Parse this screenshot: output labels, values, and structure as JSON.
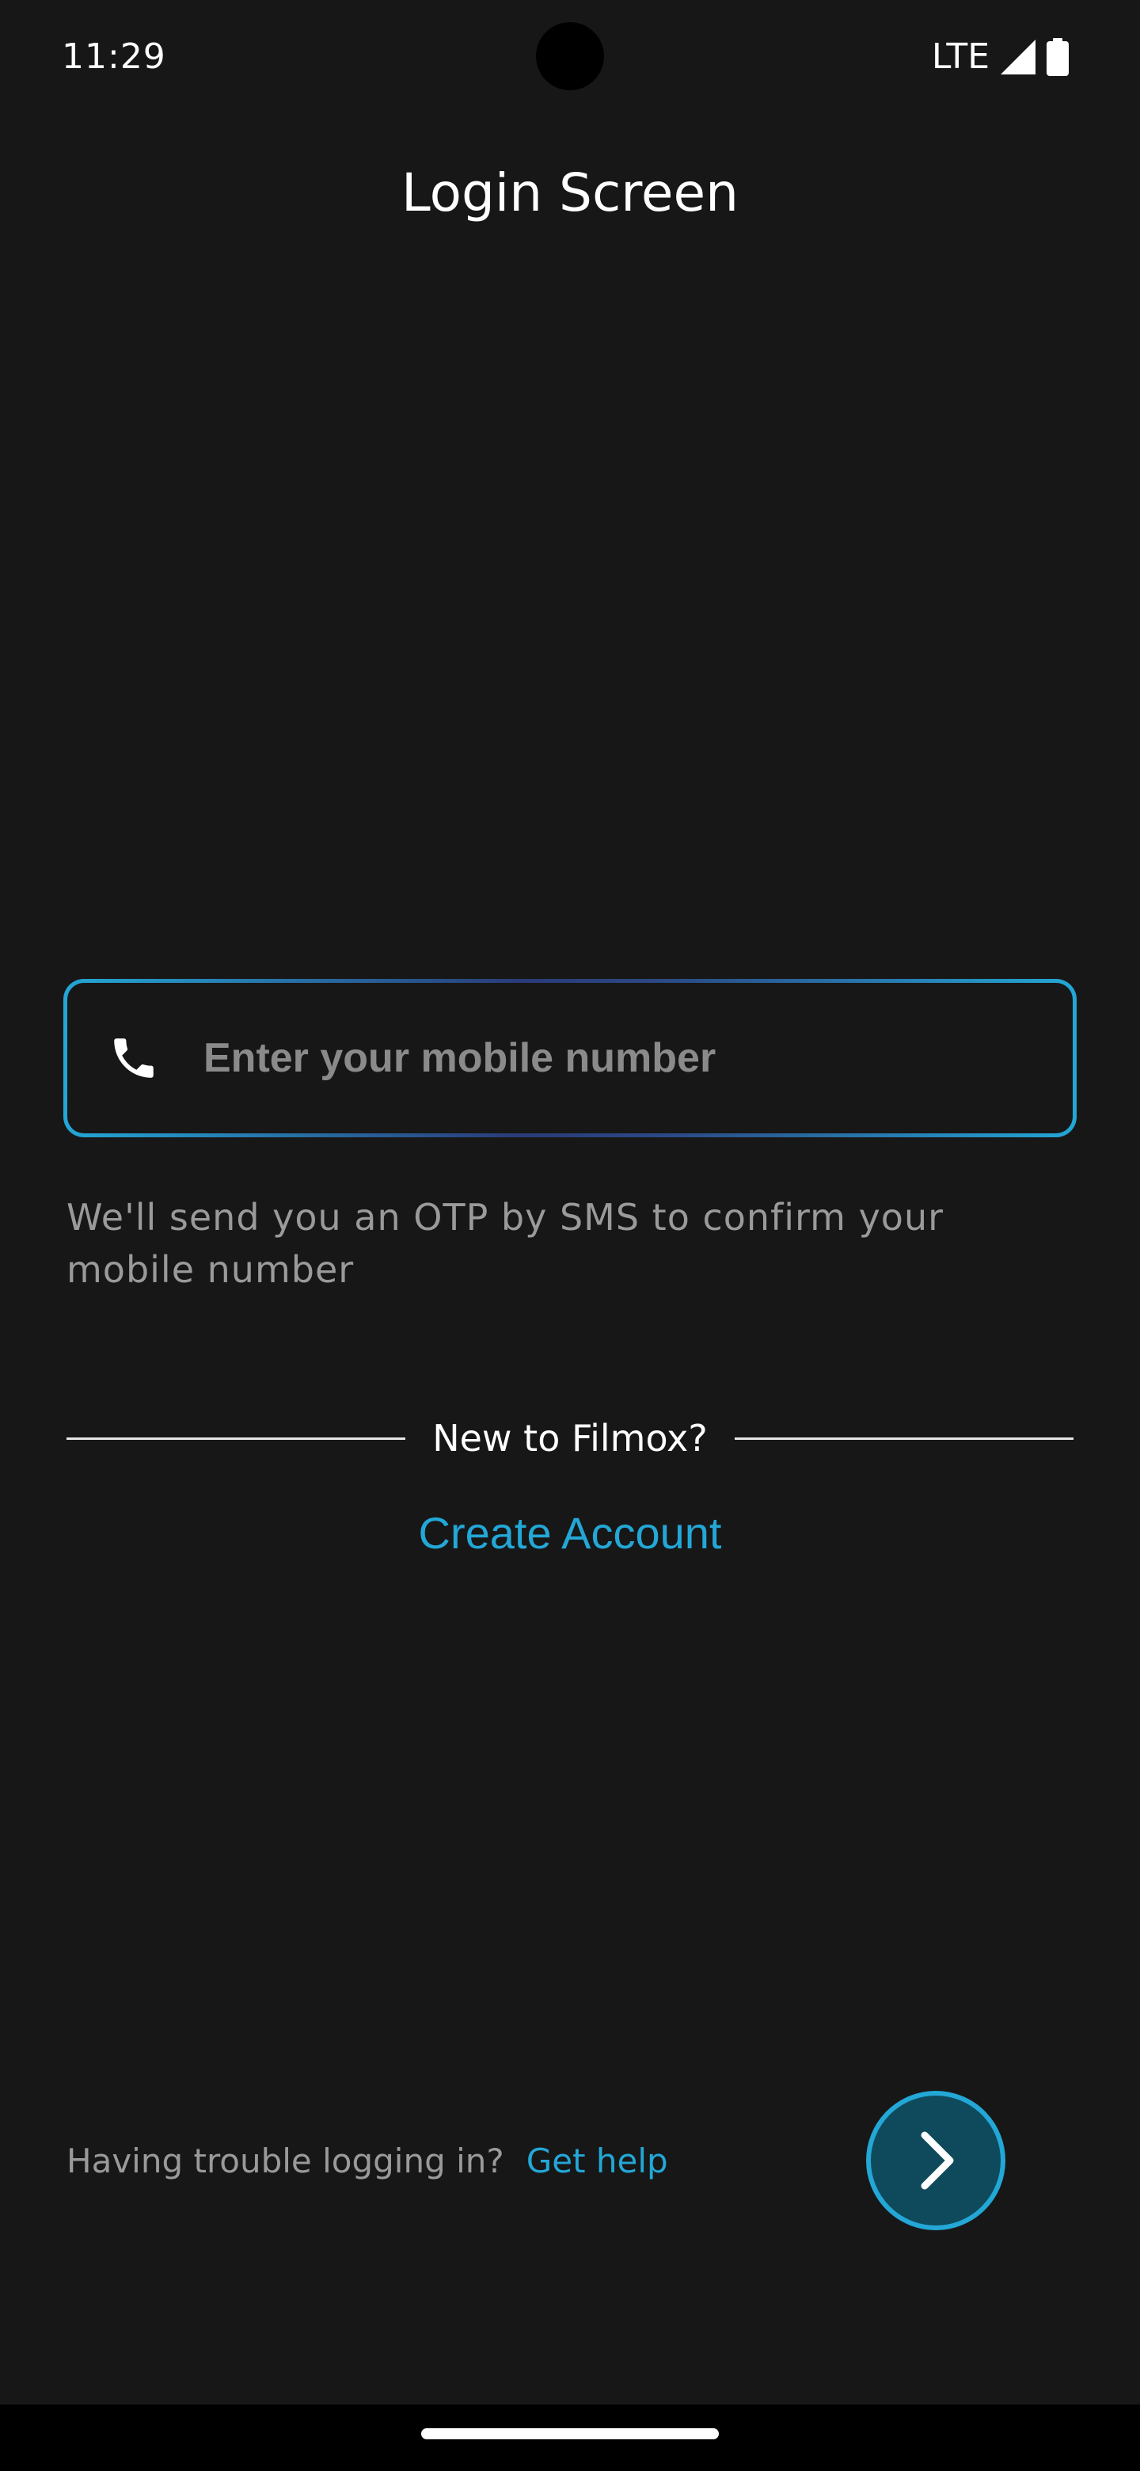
{
  "status_bar": {
    "time": "11:29",
    "network": "LTE"
  },
  "title": "Login Screen",
  "mobile_input": {
    "placeholder": "Enter your mobile number",
    "value": "",
    "icon": "phone-icon"
  },
  "otp_helper_text": "We'll send you an OTP by SMS to confirm your mobile number",
  "divider_text": "New to Filmox?",
  "create_account_label": "Create Account",
  "help": {
    "text": "Having trouble logging in?",
    "link_label": "Get help"
  },
  "next_button": {
    "icon": "chevron-right-icon"
  },
  "colors": {
    "background": "#171717",
    "accent": "#23a7d6",
    "next_button_fill": "#0f4a5c",
    "muted_text": "#9a9a9a"
  }
}
